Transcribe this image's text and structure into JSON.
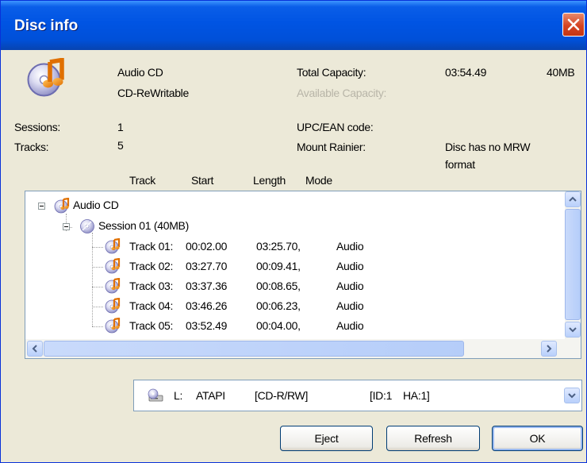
{
  "window": {
    "title": "Disc info"
  },
  "disc": {
    "type_label": "Audio CD",
    "media_label": "CD-ReWritable",
    "total_capacity_label": "Total Capacity:",
    "total_capacity_time": "03:54.49",
    "total_capacity_size": "40MB",
    "available_capacity_label": "Available Capacity:",
    "sessions_label": "Sessions:",
    "sessions_value": "1",
    "tracks_label": "Tracks:",
    "tracks_value": "5",
    "upc_label": "UPC/EAN code:",
    "mount_rainier_label": "Mount Rainier:",
    "mount_rainier_value_line1": "Disc has no MRW",
    "mount_rainier_value_line2": "format"
  },
  "columns": {
    "track": "Track",
    "start": "Start",
    "length": "Length",
    "mode": "Mode"
  },
  "tree": {
    "root_label": "Audio CD",
    "session_label": "Session 01 (40MB)",
    "tracks": [
      {
        "label": "Track 01:",
        "start": "00:02.00",
        "length": "03:25.70,",
        "mode": "Audio"
      },
      {
        "label": "Track 02:",
        "start": "03:27.70",
        "length": "00:09.41,",
        "mode": "Audio"
      },
      {
        "label": "Track 03:",
        "start": "03:37.36",
        "length": "00:08.65,",
        "mode": "Audio"
      },
      {
        "label": "Track 04:",
        "start": "03:46.26",
        "length": "00:06.23,",
        "mode": "Audio"
      },
      {
        "label": "Track 05:",
        "start": "03:52.49",
        "length": "00:04.00,",
        "mode": "Audio"
      }
    ]
  },
  "drive": {
    "letter": "L:",
    "name": "ATAPI",
    "type": "[CD-R/RW]",
    "id": "[ID:1",
    "ha": "HA:1]"
  },
  "buttons": {
    "eject": "Eject",
    "refresh": "Refresh",
    "ok": "OK"
  },
  "icons": {
    "disc": "audio-cd-icon",
    "session": "session-disc-icon",
    "track": "audio-track-icon",
    "drive": "cd-drive-icon",
    "close": "close-icon"
  },
  "colors": {
    "titlebar": "#0054e3",
    "close_button": "#d54423",
    "dialog_bg": "#ece9d8"
  }
}
